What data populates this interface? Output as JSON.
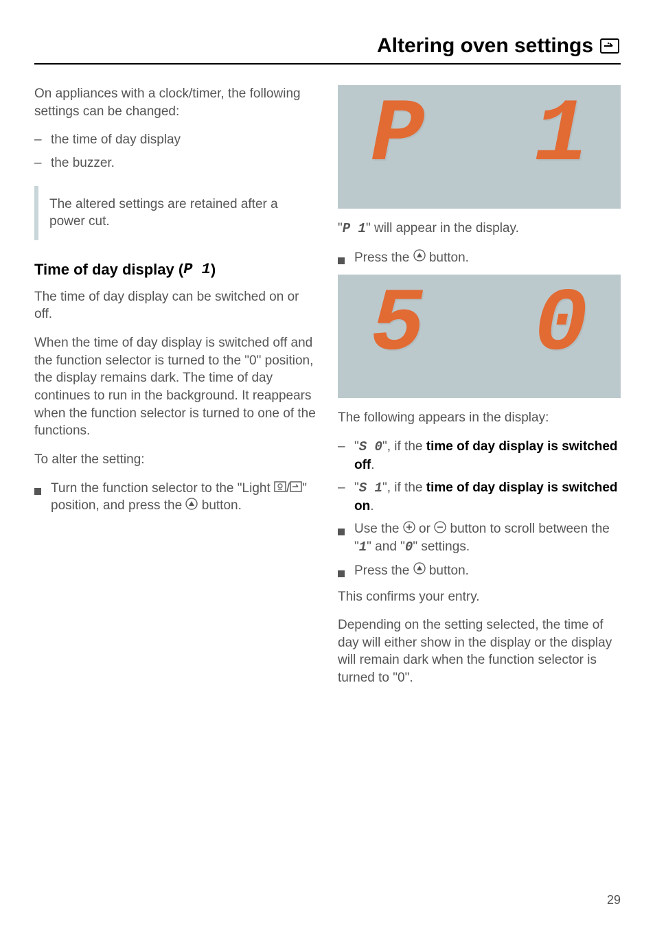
{
  "header": {
    "title": "Altering oven settings"
  },
  "left": {
    "intro": "On appliances with a clock/timer, the following settings can be changed:",
    "items": [
      "the time of day display",
      "the buzzer."
    ],
    "note": "The altered settings are retained after a power cut.",
    "sub_title_pre": "Time of day display (",
    "sub_code": "P 1",
    "sub_title_post": ")",
    "p1": "The time of day display can be switched on or off.",
    "p2": "When the time of day display is switched off and the function selector is turned to the \"0\" position, the display remains dark. The time of day continues to run in the background. It reappears when the function selector is turned to one of the functions.",
    "p3": "To alter the setting:",
    "step1_pre": "Turn the function selector to the \"Light ",
    "step1_post": "\" position, and press the ",
    "step1_end": " button."
  },
  "right": {
    "display1": {
      "c1": "P",
      "c2": "1"
    },
    "display1_caption_pre": "\"",
    "display1_code": "P 1",
    "display1_caption_post": "\" will appear in the display.",
    "press1": "Press the ",
    "press1_end": " button.",
    "display2": {
      "c1": "5",
      "c2": "0"
    },
    "caption2": "The following appears in the display:",
    "opt1_pre": "\"",
    "opt1_code": "S 0",
    "opt1_mid": "\", if the ",
    "opt1_bold": "time of day display is switched off",
    "opt1_end": ".",
    "opt2_pre": "\"",
    "opt2_code": "S 1",
    "opt2_mid": "\", if the ",
    "opt2_bold": "time of day display is switched on",
    "opt2_end": ".",
    "scroll_pre": "Use the ",
    "scroll_mid": " or ",
    "scroll_post": " button to scroll between the \"",
    "scroll_code1": "1",
    "scroll_and": "\" and \"",
    "scroll_code0": "0",
    "scroll_end": "\" settings.",
    "press2": "Press the ",
    "press2_end": " button.",
    "confirm": "This confirms your entry.",
    "depend": "Depending on the setting selected, the time of day will either show in the display or the display will remain dark when the function selector is turned to \"0\"."
  },
  "page": "29"
}
